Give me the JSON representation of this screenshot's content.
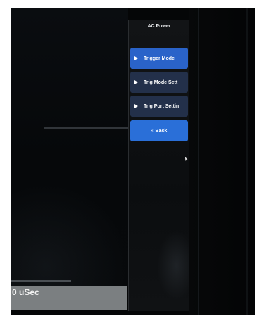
{
  "menu": {
    "title": "AC Power",
    "items": [
      {
        "label": "Trigger Mode",
        "icon": "play-arrow-icon"
      },
      {
        "label": "Trig Mode Sett",
        "icon": "play-arrow-icon"
      },
      {
        "label": "Trig Port Settin",
        "icon": "play-arrow-icon"
      }
    ],
    "back_label": "« Back"
  },
  "status": {
    "time_readout": "0 uSec"
  },
  "colors": {
    "button_active": "#2a63c9",
    "button_inactive": "#23304a",
    "back_button": "#2a6fd8",
    "status_bar": "#7b7f81"
  }
}
